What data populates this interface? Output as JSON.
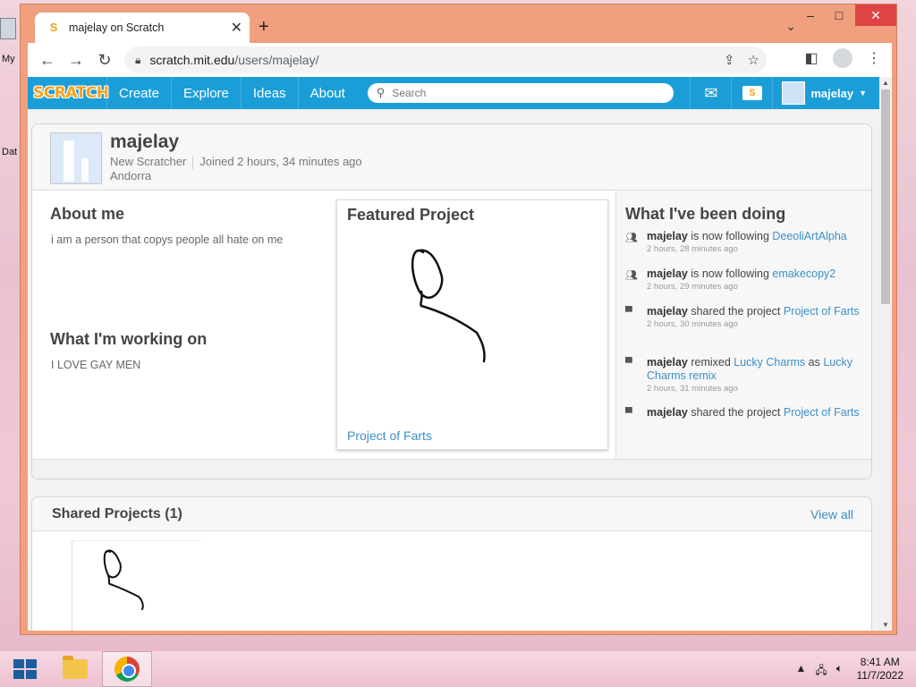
{
  "desktop": {
    "icon_labels": [
      "My",
      "Dat"
    ]
  },
  "browser": {
    "tab_title": "majelay on Scratch",
    "tab_favicon": "S",
    "url_host": "scratch.mit.edu",
    "url_path": "/users/majelay/"
  },
  "scratch_nav": {
    "logo": "SCRATCH",
    "links": [
      "Create",
      "Explore",
      "Ideas",
      "About"
    ],
    "search_placeholder": "Search",
    "mystuff_glyph": "S",
    "username": "majelay"
  },
  "profile": {
    "username": "majelay",
    "role": "New Scratcher",
    "joined": "Joined 2 hours, 34 minutes ago",
    "location": "Andorra",
    "about_heading": "About me",
    "about_text": "i am a person that copys people all hate on me",
    "working_heading": "What I'm working on",
    "working_text": "I LOVE GAY MEN",
    "featured_heading": "Featured Project",
    "featured_title": "Project of Farts",
    "activity_heading": "What I've been doing",
    "activity": [
      {
        "user": "majelay",
        "verb": " is now following ",
        "target": "DeeoliArtAlpha",
        "time": "2 hours, 28 minutes ago",
        "icon": "follow-icon"
      },
      {
        "user": "majelay",
        "verb": " is now following ",
        "target": "emakecopy2",
        "time": "2 hours, 29 minutes ago",
        "icon": "follow-icon"
      },
      {
        "user": "majelay",
        "verb": " shared the project ",
        "target": "Project of Farts",
        "time": "2 hours, 30 minutes ago",
        "icon": "share-icon"
      },
      {
        "user": "majelay",
        "verb": " remixed ",
        "target": "Lucky Charms",
        "mid": " as ",
        "target2": "Lucky Charms remix",
        "time": "2 hours, 31 minutes ago",
        "icon": "remix-icon"
      },
      {
        "user": "majelay",
        "verb": " shared the project ",
        "target": "Project of Farts",
        "time": "",
        "icon": "share-icon"
      }
    ]
  },
  "shared": {
    "title": "Shared Projects (1)",
    "view_all": "View all"
  },
  "taskbar": {
    "time": "8:41 AM",
    "date": "11/7/2022"
  },
  "colors": {
    "scratch_blue": "#1b9ed8",
    "link_blue": "#3d8fc7",
    "window_frame": "#f0a07e",
    "scratch_orange": "#f7a21a"
  }
}
